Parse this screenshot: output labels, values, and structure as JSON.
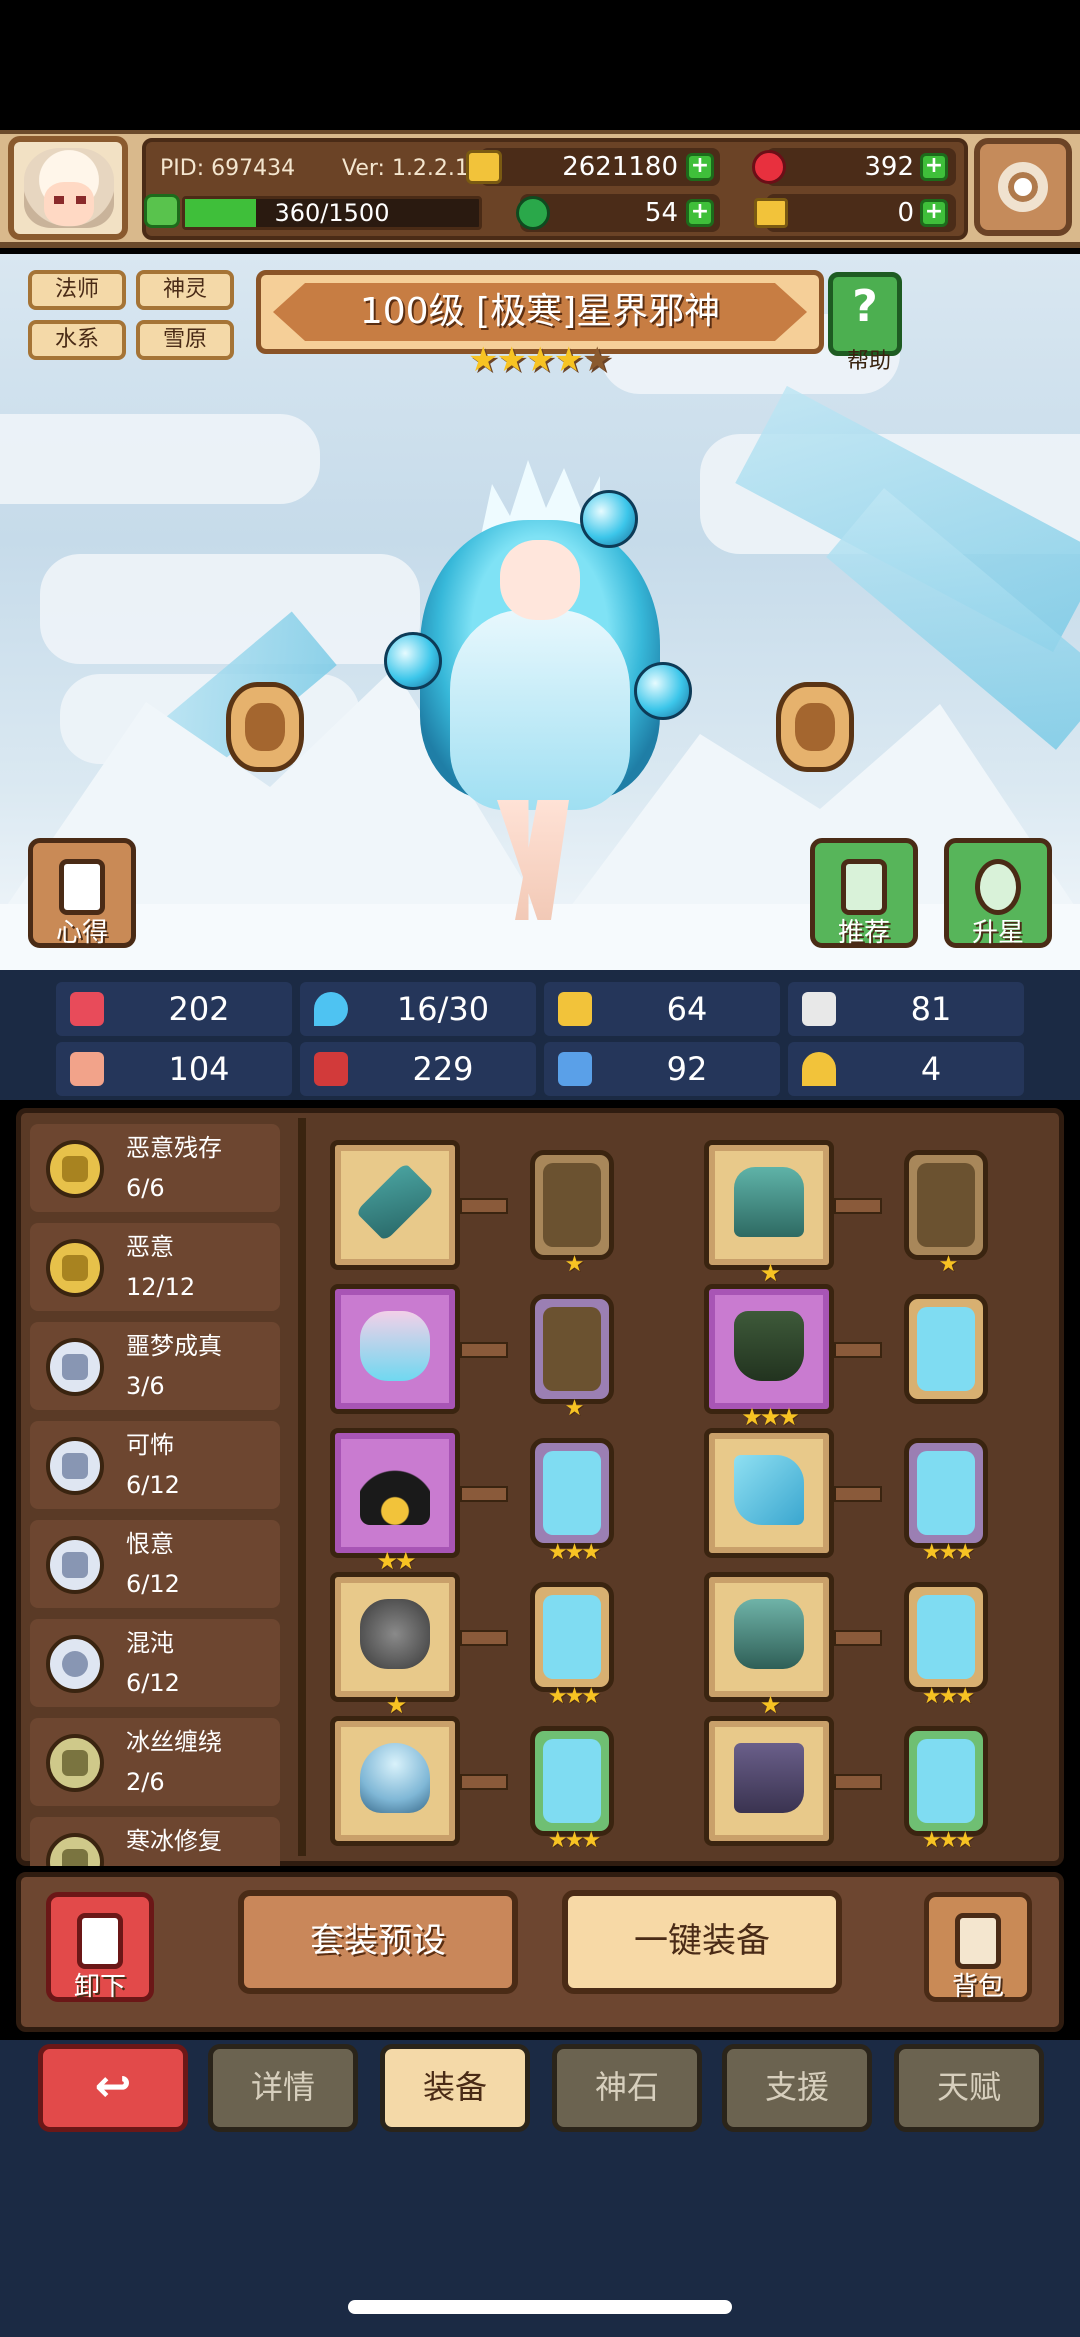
{
  "header": {
    "pid": "PID: 697434",
    "version": "Ver: 1.2.2.1",
    "gold": "2621180",
    "ruby": "392",
    "clover": "54",
    "key": "0",
    "exp": "360/1500",
    "exp_fraction": 0.24
  },
  "tags": [
    "法师",
    "神灵",
    "水系",
    "雪原"
  ],
  "hero": {
    "title": "100级 [极寒]星界邪神",
    "stars_filled": 4,
    "stars_total": 5,
    "stars": "★★★★★",
    "help_label": "帮助"
  },
  "side_buttons": {
    "insight": "心得",
    "recommend": "推荐",
    "star_up": "升星"
  },
  "stats": [
    {
      "icon": "heart-icon",
      "value": "202",
      "color": "#e84b5a"
    },
    {
      "icon": "water-drop-icon",
      "value": "16/30",
      "color": "#4ec3f2"
    },
    {
      "icon": "shield-icon",
      "value": "64",
      "color": "#f2c33a"
    },
    {
      "icon": "feather-icon",
      "value": "81",
      "color": "#e8e8e8"
    },
    {
      "icon": "fist-icon",
      "value": "104",
      "color": "#f2a38a"
    },
    {
      "icon": "spellbook-icon",
      "value": "229",
      "color": "#d23a3a"
    },
    {
      "icon": "boot-icon",
      "value": "92",
      "color": "#5aa0e8"
    },
    {
      "icon": "horseshoe-icon",
      "value": "4",
      "color": "#f2c33a"
    }
  ],
  "sets": [
    {
      "name": "恶意残存",
      "count": "6/6",
      "medal": "gold"
    },
    {
      "name": "恶意",
      "count": "12/12",
      "medal": "gold"
    },
    {
      "name": "噩梦成真",
      "count": "3/6",
      "medal": "silver"
    },
    {
      "name": "可怖",
      "count": "6/12",
      "medal": "silver"
    },
    {
      "name": "恨意",
      "count": "6/12",
      "medal": "silver"
    },
    {
      "name": "混沌",
      "count": "6/12",
      "medal": "silver"
    },
    {
      "name": "冰丝缠绕",
      "count": "2/6",
      "medal": "olive"
    },
    {
      "name": "寒冰修复",
      "count": "",
      "medal": "olive"
    }
  ],
  "equipment": [
    {
      "slot": "staff",
      "frame": "gold",
      "stars": "",
      "gem": "bronze",
      "gem_stars": "★"
    },
    {
      "slot": "armor",
      "frame": "gold",
      "stars": "★",
      "gem": "bronze",
      "gem_stars": "★"
    },
    {
      "slot": "crystal-helm",
      "frame": "purple",
      "stars": "",
      "gem": "bronze-purple",
      "gem_stars": "★"
    },
    {
      "slot": "dark-robe",
      "frame": "purple",
      "stars": "★★★",
      "gem": "ice",
      "gem_stars": ""
    },
    {
      "slot": "necklace",
      "frame": "purple",
      "stars": "★★",
      "gem": "ice-purple",
      "gem_stars": "★★★"
    },
    {
      "slot": "ice-glove",
      "frame": "gold",
      "stars": "",
      "gem": "ice-purple",
      "gem_stars": "★★★"
    },
    {
      "slot": "stone-ring",
      "frame": "gold",
      "stars": "★",
      "gem": "ice",
      "gem_stars": "★★★"
    },
    {
      "slot": "mask",
      "frame": "gold",
      "stars": "★",
      "gem": "ice",
      "gem_stars": "★★★"
    },
    {
      "slot": "ice-ring",
      "frame": "gold",
      "stars": "",
      "gem": "ice-green",
      "gem_stars": "★★★"
    },
    {
      "slot": "boots",
      "frame": "gold",
      "stars": "",
      "gem": "ice-green",
      "gem_stars": "★★★"
    }
  ],
  "actions": {
    "unequip": "卸下",
    "preset": "套装预设",
    "auto_equip": "一键装备",
    "bag": "背包"
  },
  "tabs": [
    "详情",
    "装备",
    "神石",
    "支援",
    "天赋"
  ],
  "active_tab": "装备",
  "colors": {
    "panel_brown": "#5a3a26",
    "stat_bar": "#1b2a44",
    "accent_gold": "#f7c323",
    "button_red": "#e24a4a"
  }
}
